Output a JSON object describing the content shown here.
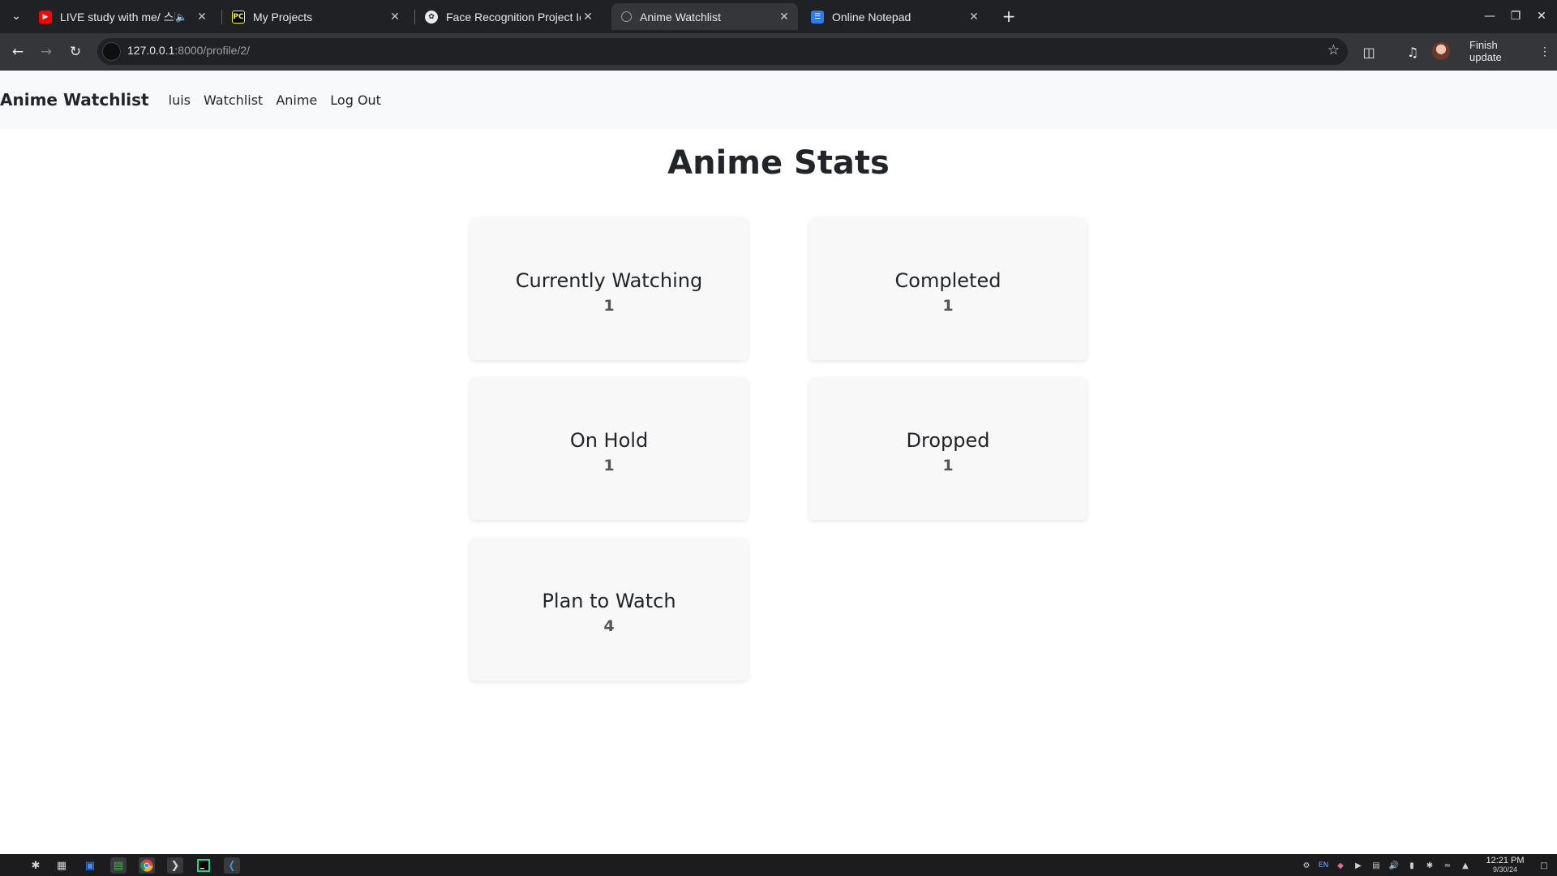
{
  "browser": {
    "tabs": [
      {
        "title": "LIVE study with me/ 스터",
        "favicon": "youtube-icon",
        "audio": true,
        "active": false
      },
      {
        "title": "My Projects",
        "favicon": "pycharm-icon",
        "audio": false,
        "active": false
      },
      {
        "title": "Face Recognition Project Id",
        "favicon": "chatgpt-icon",
        "audio": false,
        "active": false
      },
      {
        "title": "Anime Watchlist",
        "favicon": "globe-icon",
        "audio": false,
        "active": true
      },
      {
        "title": "Online Notepad",
        "favicon": "notepad-icon",
        "audio": false,
        "active": false
      }
    ],
    "url_host": "127.0.0.1",
    "url_rest": ":8000/profile/2/",
    "finish_update_label": "Finish update"
  },
  "site": {
    "brand": "Anime Watchlist",
    "nav": [
      "luis",
      "Watchlist",
      "Anime",
      "Log Out"
    ]
  },
  "main": {
    "title": "Anime Stats",
    "stats": [
      {
        "label": "Currently Watching",
        "count": "1"
      },
      {
        "label": "Completed",
        "count": "1"
      },
      {
        "label": "On Hold",
        "count": "1"
      },
      {
        "label": "Dropped",
        "count": "1"
      },
      {
        "label": "Plan to Watch",
        "count": "4"
      }
    ]
  },
  "taskbar": {
    "language": "EN",
    "time": "12:21 PM",
    "date": "9/30/24"
  },
  "colors": {
    "tabbar": "#202124",
    "toolbar": "#35363a",
    "navbar_bg": "#f8f9fa",
    "card_bg": "#f8f8f8"
  }
}
